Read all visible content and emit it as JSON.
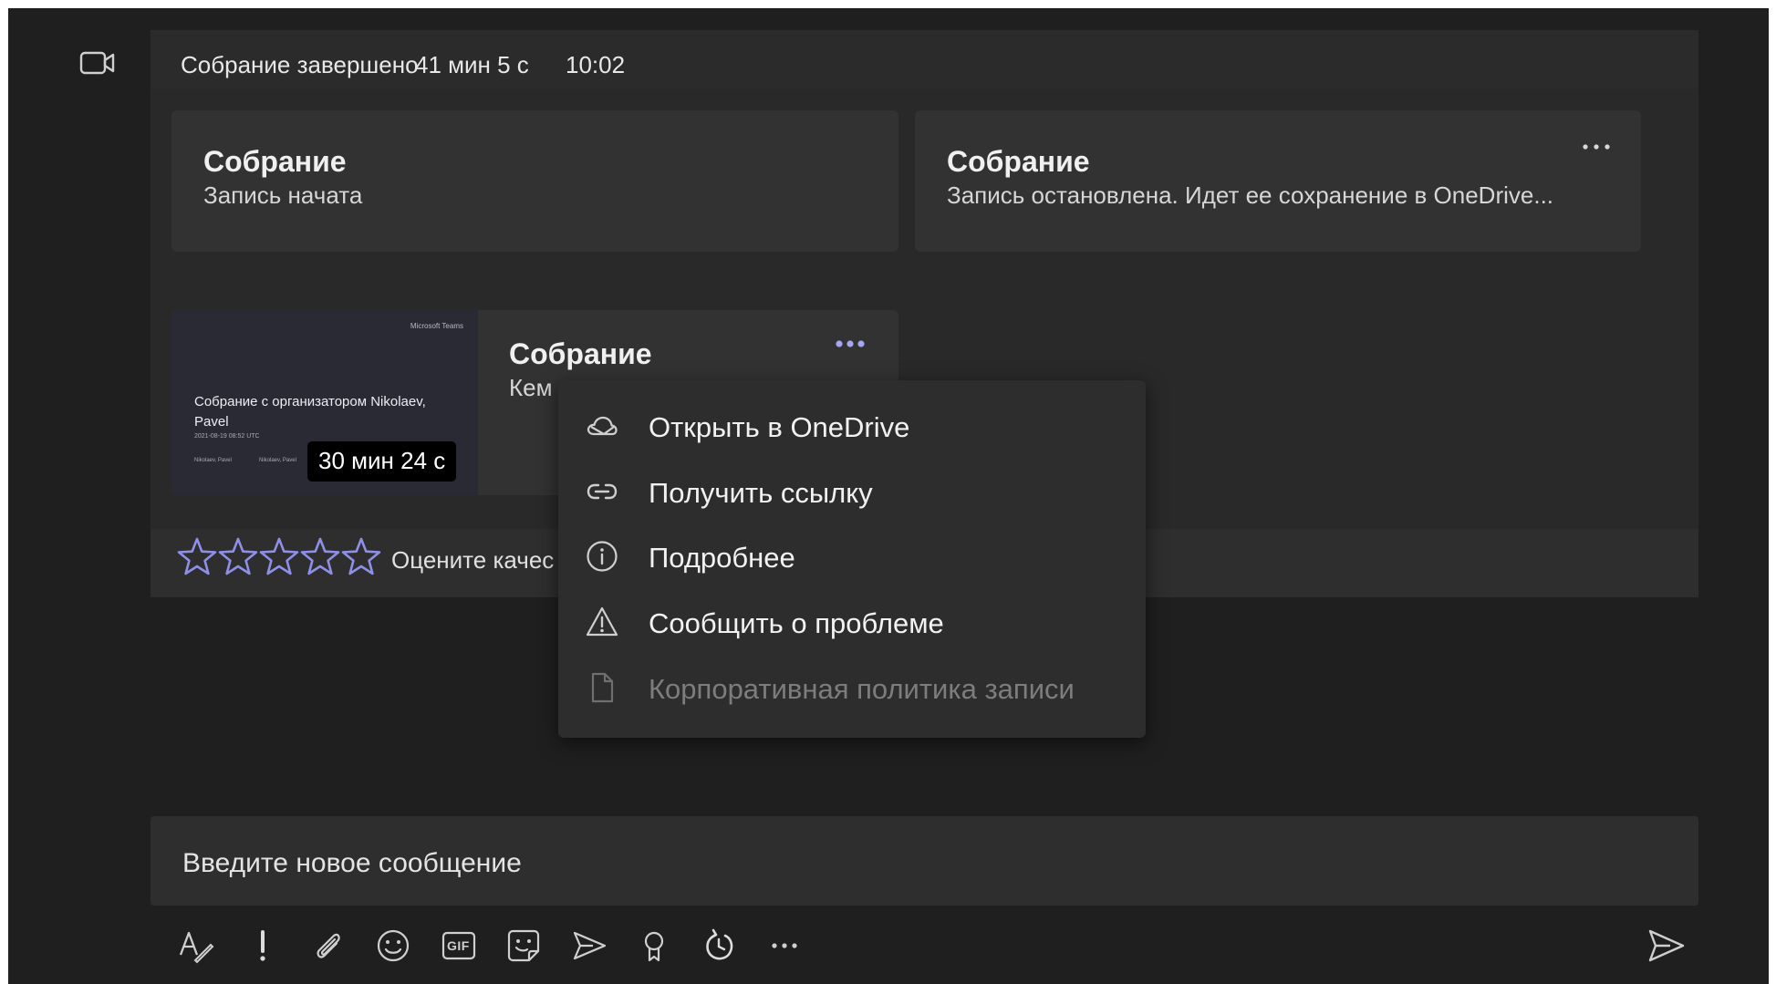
{
  "header": {
    "status": "Собрание завершено",
    "duration": "41 мин 5 с",
    "time": "10:02"
  },
  "cards": [
    {
      "title": "Собрание",
      "subtitle": "Запись начата"
    },
    {
      "title": "Собрание",
      "subtitle": "Запись остановлена. Идет ее сохранение в OneDrive..."
    }
  ],
  "recording": {
    "title": "Собрание",
    "subtitle_partial": "Кем",
    "duration": "30 мин 24 с",
    "thumbnail": {
      "brand": "Microsoft Teams",
      "title": "Собрание с организатором Nikolaev, Pavel",
      "date": "2021-08-19 08:52 UTC",
      "left_name": "Nikolaev, Pavel",
      "right_name": "Nikolaev, Pavel"
    }
  },
  "rating": {
    "prompt": "Оцените качес",
    "stars_total": 5,
    "stars_filled": 0
  },
  "context_menu": {
    "items": [
      {
        "label": "Открыть в OneDrive",
        "icon": "cloud-icon",
        "enabled": true
      },
      {
        "label": "Получить ссылку",
        "icon": "link-icon",
        "enabled": true
      },
      {
        "label": "Подробнее",
        "icon": "info-icon",
        "enabled": true
      },
      {
        "label": "Сообщить о проблеме",
        "icon": "warning-icon",
        "enabled": true
      },
      {
        "label": "Корпоративная политика записи",
        "icon": "document-icon",
        "enabled": false
      }
    ]
  },
  "compose": {
    "placeholder": "Введите новое сообщение"
  },
  "toolbar": {
    "gif_label": "GIF",
    "items": [
      "format-icon",
      "important-icon",
      "attach-icon",
      "emoji-icon",
      "gif-icon",
      "sticker-icon",
      "meet-now-icon",
      "praise-icon",
      "loop-icon",
      "more-icon"
    ]
  },
  "colors": {
    "background": "#1f1f1f",
    "panel": "#292929",
    "card": "#323232",
    "accent": "#a4a6f1",
    "star_outline": "#8e90e8"
  }
}
